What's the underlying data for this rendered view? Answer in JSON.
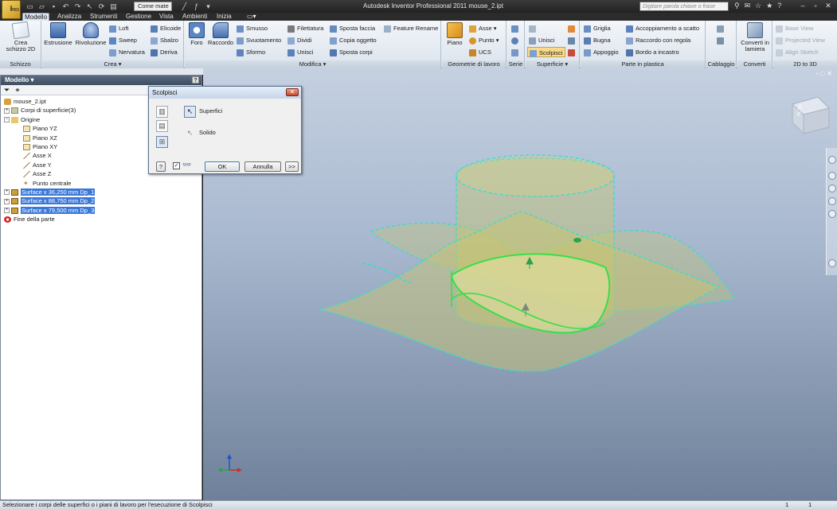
{
  "app": {
    "logo_letter": "I",
    "logo_sub": "PRO",
    "title": "Autodesk Inventor Professional 2011   mouse_2.ipt",
    "appearance": "Come mate",
    "help_placeholder": "Digitare parola chiave o frase"
  },
  "tabs": [
    {
      "label": "Modello"
    },
    {
      "label": "Analizza"
    },
    {
      "label": "Strumenti"
    },
    {
      "label": "Gestione"
    },
    {
      "label": "Vista"
    },
    {
      "label": "Ambienti"
    },
    {
      "label": "Inizia"
    }
  ],
  "ribbon": {
    "schizzo": {
      "title": "Schizzo",
      "crea_schizzo": "Crea",
      "crea_schizzo2": "schizzo 2D"
    },
    "crea": {
      "title": "Crea",
      "estrusione": "Estrusione",
      "rivoluzione": "Rivoluzione",
      "loft": "Loft",
      "sweep": "Sweep",
      "nervatura": "Nervatura",
      "elicoide": "Elicoide",
      "sbalzo": "Sbalzo",
      "deriva": "Deriva"
    },
    "modifica": {
      "title": "Modifica",
      "foro": "Foro",
      "raccordo": "Raccordo",
      "smusso": "Smusso",
      "svuotamento": "Svuotamento",
      "sformo": "Sformo",
      "filettatura": "Filettatura",
      "dividi": "Dividi",
      "unisci": "Unisci",
      "sposta_faccia": "Sposta faccia",
      "copia_oggetto": "Copia oggetto",
      "sposta_corpi": "Sposta corpi",
      "feature_rename": "Feature Rename"
    },
    "geometrie": {
      "title": "Geometrie di lavoro",
      "piano": "Piano",
      "asse": "Asse",
      "punto": "Punto",
      "ucs": "UCS"
    },
    "serie": {
      "title": "Serie"
    },
    "superficie": {
      "title": "Superficie",
      "unisci": "Unisci",
      "scolpisci": "Scolpisci"
    },
    "plastica": {
      "title": "Parte in plastica",
      "griglia": "Griglia",
      "bugna": "Bugna",
      "appoggio": "Appoggio",
      "accoppiamento": "Accoppiamento a scatto",
      "raccordo_regola": "Raccordo con regola",
      "bordo": "Bordo a incastro"
    },
    "cablaggio": {
      "title": "Cablaggio"
    },
    "converti": {
      "title": "Converti",
      "label1": "Converti in",
      "label2": "lamiera"
    },
    "d2d3": {
      "title": "2D to 3D",
      "base_view": "Base View",
      "projected_view": "Projected View",
      "align_sketch": "Align Sketch"
    }
  },
  "browser": {
    "title": "Modello",
    "help": "?",
    "nodes": [
      {
        "label": "mouse_2.ipt"
      },
      {
        "label": "Corpi di superficie(3)"
      },
      {
        "label": "Origine"
      },
      {
        "label": "Piano YZ"
      },
      {
        "label": "Piano XZ"
      },
      {
        "label": "Piano XY"
      },
      {
        "label": "Asse X"
      },
      {
        "label": "Asse Y"
      },
      {
        "label": "Asse Z"
      },
      {
        "label": "Punto centrale"
      },
      {
        "label": "Surface x 36,250 mm Dp_1"
      },
      {
        "label": "Surface x 88,750 mm Dp_2"
      },
      {
        "label": "Surface x 79,500 mm Dp_3"
      },
      {
        "label": "Fine della parte"
      }
    ]
  },
  "dialog": {
    "title": "Scolpisci",
    "option_surface": "Superfici",
    "option_solid": "Solido",
    "ok": "OK",
    "cancel": "Annulla",
    "more": ">>",
    "help": "?"
  },
  "viewcube": {
    "label": "ALTO"
  },
  "status": {
    "message": "Selezionare i corpi delle superfici o i piani di lavoro per l'esecuzione di Scolpisci",
    "n1": "1",
    "n2": "1"
  },
  "colors": {
    "surface_fill": "#c9c66a",
    "surface_edge": "#2ee0d0",
    "selection": "#36e04a"
  }
}
